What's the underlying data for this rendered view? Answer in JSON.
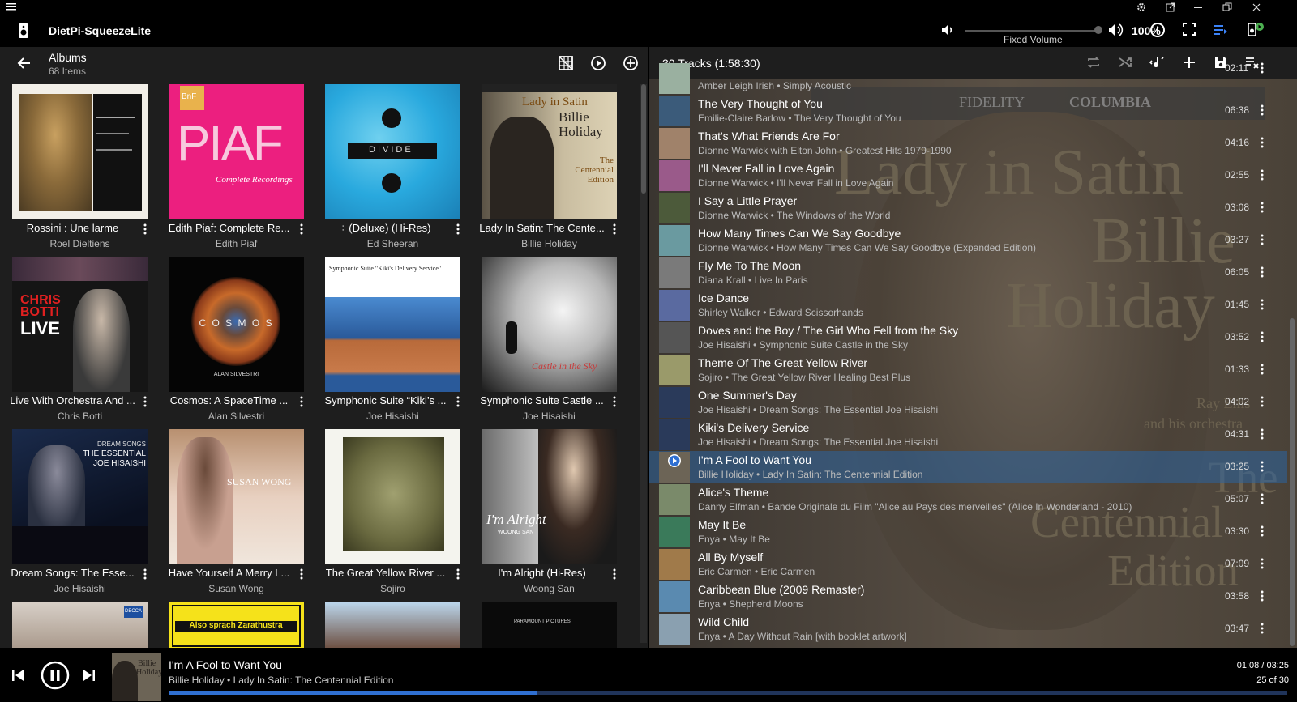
{
  "header": {
    "player_name": "DietPi-SqueezeLite",
    "volume_label": "Fixed Volume",
    "volume_percent": "100%"
  },
  "browse": {
    "title": "Albums",
    "subtitle": "68 Items",
    "albums": [
      {
        "title": "Rossini : Une larme",
        "artist": "Roel Dieltiens"
      },
      {
        "title": "Edith Piaf: Complete Re...",
        "artist": "Edith Piaf"
      },
      {
        "title": "÷ (Deluxe) (Hi-Res)",
        "artist": "Ed Sheeran"
      },
      {
        "title": "Lady In Satin: The Cente...",
        "artist": "Billie Holiday"
      },
      {
        "title": "Live With Orchestra And ...",
        "artist": "Chris Botti"
      },
      {
        "title": "Cosmos: A SpaceTime ...",
        "artist": "Alan Silvestri"
      },
      {
        "title": "Symphonic Suite “Kiki’s ...",
        "artist": "Joe Hisaishi"
      },
      {
        "title": "Symphonic Suite Castle ...",
        "artist": "Joe Hisaishi"
      },
      {
        "title": "Dream Songs: The Esse...",
        "artist": "Joe Hisaishi"
      },
      {
        "title": "Have Yourself A Merry L...",
        "artist": "Susan Wong"
      },
      {
        "title": "The Great Yellow River ...",
        "artist": "Sojiro"
      },
      {
        "title": "I'm Alright (Hi-Res)",
        "artist": "Woong San"
      }
    ],
    "cover_text": {
      "piaf": "PIAF",
      "piaf_sub": "Complete Recordings",
      "piaf_badge": "BnF",
      "divide": "DIVIDE",
      "lady_title": "Lady in Satin",
      "lady_artist": "Billie Holiday",
      "lady_edition": "The Centennial Edition",
      "botti1": "CHRIS",
      "botti2": "BOTTI",
      "botti3": "LIVE",
      "cosmos": "C O S M O S",
      "cosmos_credit": "ALAN SILVESTRI",
      "kiki": "Symphonic Suite \"Kiki's Delivery Service\"",
      "castle": "Castle in the Sky",
      "dream1": "DREAM SONGS",
      "dream2": "THE ESSENTIAL",
      "dream3": "JOE HISAISHI",
      "susan": "SUSAN WONG",
      "alright": "I'm Alright",
      "woong": "WOONG SAN",
      "decca": "DECCA",
      "zara": "Also sprach Zarathustra",
      "paramount": "PARAMOUNT PICTURES"
    }
  },
  "queue": {
    "header": "30 Tracks (1:58:30)",
    "background_text": [
      "Lady in Satin",
      "Billie",
      "Holiday",
      "The",
      "Centennial",
      "Edition",
      "Ray Ellis",
      "and his orchestra",
      "FIDELITY",
      "COLUMBIA"
    ],
    "partial_top": {
      "subtitle": "Amber Leigh Irish • Simply Acoustic",
      "duration": "02:11"
    },
    "tracks": [
      {
        "title": "The Very Thought of You",
        "subtitle": "Emilie-Claire Barlow • The Very Thought of You",
        "duration": "06:38",
        "color": "#3b5b7a"
      },
      {
        "title": "That's What Friends Are For",
        "subtitle": "Dionne Warwick with Elton John • Greatest Hits 1979-1990",
        "duration": "04:16",
        "color": "#a0826a"
      },
      {
        "title": "I'll Never Fall in Love Again",
        "subtitle": "Dionne Warwick • I'll Never Fall in Love Again",
        "duration": "02:55",
        "color": "#9a5a8a"
      },
      {
        "title": "I Say a Little Prayer",
        "subtitle": "Dionne Warwick • The Windows of the World",
        "duration": "03:08",
        "color": "#4c5a3a"
      },
      {
        "title": "How Many Times Can We Say Goodbye",
        "subtitle": "Dionne Warwick • How Many Times Can We Say Goodbye (Expanded Edition)",
        "duration": "03:27",
        "color": "#6a9aa0"
      },
      {
        "title": "Fly Me To The Moon",
        "subtitle": "Diana Krall • Live In Paris",
        "duration": "06:05",
        "color": "#7a7a7a"
      },
      {
        "title": "Ice Dance",
        "subtitle": "Shirley Walker • Edward Scissorhands",
        "duration": "01:45",
        "color": "#5a6aa0"
      },
      {
        "title": "Doves and the Boy / The Girl Who Fell from the Sky",
        "subtitle": "Joe Hisaishi • Symphonic Suite Castle in the Sky",
        "duration": "03:52",
        "color": "#555555"
      },
      {
        "title": "Theme Of The Great Yellow River",
        "subtitle": "Sojiro • The Great Yellow River Healing Best Plus",
        "duration": "01:33",
        "color": "#9a9a6a"
      },
      {
        "title": "One Summer's Day",
        "subtitle": "Joe Hisaishi • Dream Songs: The Essential Joe Hisaishi",
        "duration": "04:02",
        "color": "#2a3a5a"
      },
      {
        "title": "Kiki's Delivery Service",
        "subtitle": "Joe Hisaishi • Dream Songs: The Essential Joe Hisaishi",
        "duration": "04:31",
        "color": "#2a3a5a"
      },
      {
        "title": "I'm A Fool to Want You",
        "subtitle": "Billie Holiday • Lady In Satin: The Centennial Edition",
        "duration": "03:25",
        "color": "#6c6456",
        "current": true
      },
      {
        "title": "Alice's Theme",
        "subtitle": "Danny Elfman • Bande Originale du Film \"Alice au Pays des merveilles\" (Alice In Wonderland - 2010)",
        "duration": "05:07",
        "color": "#7a8a6a"
      },
      {
        "title": "May It Be",
        "subtitle": "Enya • May It Be",
        "duration": "03:30",
        "color": "#3a7a5a"
      },
      {
        "title": "All By Myself",
        "subtitle": "Eric Carmen • Eric Carmen",
        "duration": "07:09",
        "color": "#a07a4a"
      },
      {
        "title": "Caribbean Blue (2009 Remaster)",
        "subtitle": "Enya • Shepherd Moons",
        "duration": "03:58",
        "color": "#5a8ab0"
      },
      {
        "title": "Wild Child",
        "subtitle": "Enya • A Day Without Rain [with booklet artwork]",
        "duration": "03:47",
        "color": "#8aa0b0"
      }
    ]
  },
  "now_playing": {
    "title": "I'm A Fool to Want You",
    "subtitle": "Billie Holiday • Lady In Satin: The Centennial Edition",
    "time": "01:08 / 03:25",
    "position": "25 of 30",
    "progress": 0.33,
    "art_text1": "Billie",
    "art_text2": "Holiday"
  },
  "colors": {
    "accent": "#2f6fd1",
    "current_row": "#2c64a0"
  }
}
